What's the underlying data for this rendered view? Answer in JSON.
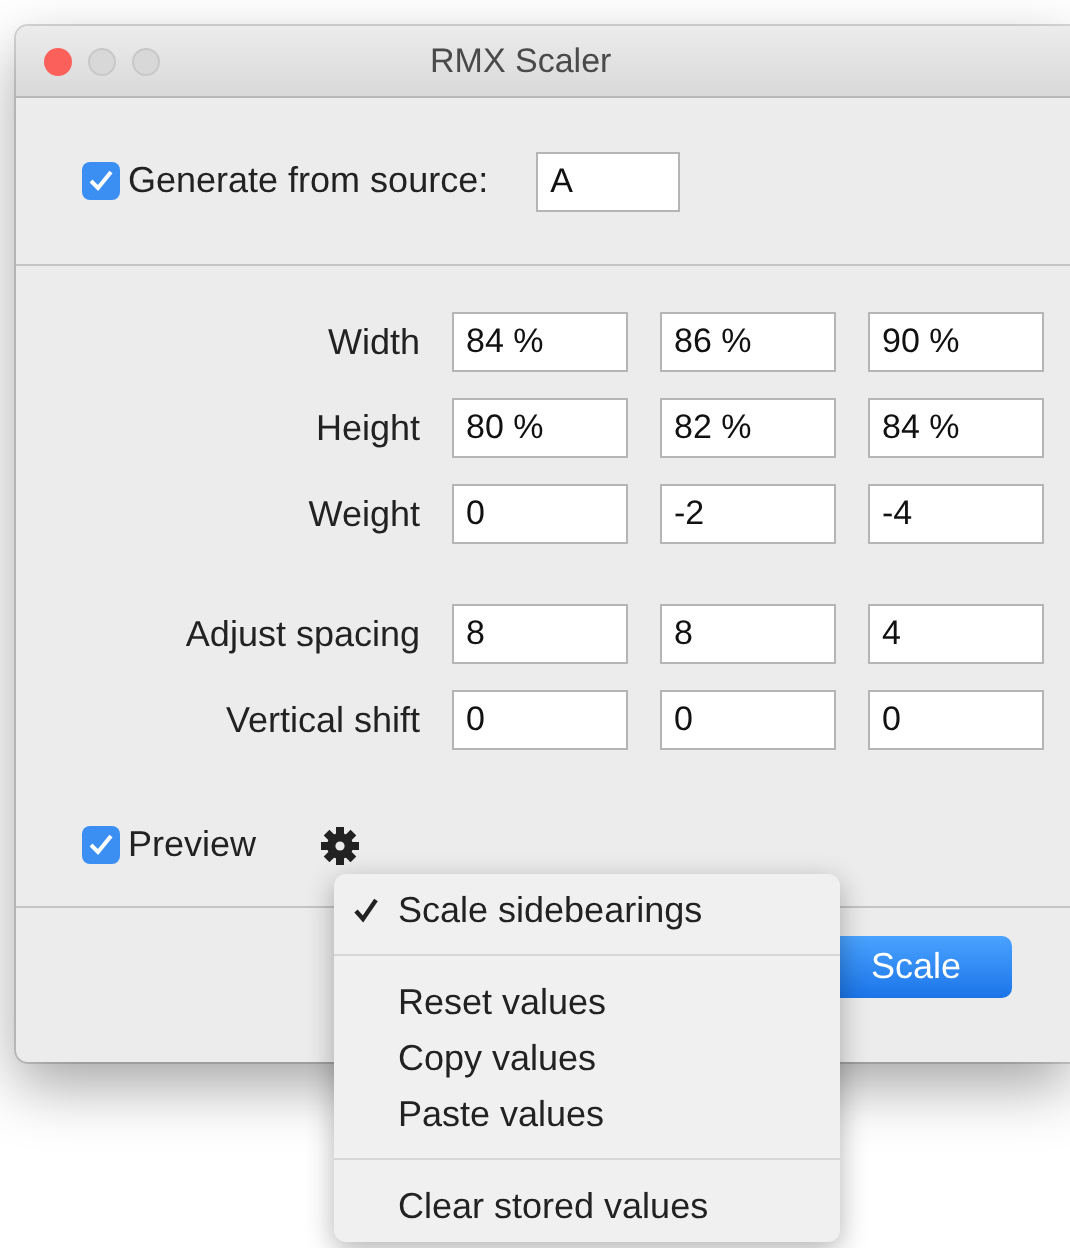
{
  "window": {
    "title": "RMX Scaler"
  },
  "source": {
    "label": "Generate from source:",
    "checked": true,
    "value": "A"
  },
  "groups": [
    {
      "rows": [
        {
          "label": "Width",
          "values": [
            "84 %",
            "86 %",
            "90 %"
          ]
        },
        {
          "label": "Height",
          "values": [
            "80 %",
            "82 %",
            "84 %"
          ]
        },
        {
          "label": "Weight",
          "values": [
            "0",
            "-2",
            "-4"
          ]
        }
      ]
    },
    {
      "rows": [
        {
          "label": "Adjust spacing",
          "values": [
            "8",
            "8",
            "4"
          ]
        },
        {
          "label": "Vertical shift",
          "values": [
            "0",
            "0",
            "0"
          ]
        }
      ]
    }
  ],
  "preview": {
    "label": "Preview",
    "checked": true
  },
  "menu": [
    {
      "kind": "item",
      "label": "Scale sidebearings",
      "checked": true
    },
    {
      "kind": "separator"
    },
    {
      "kind": "item",
      "label": "Reset values",
      "checked": false
    },
    {
      "kind": "item",
      "label": "Copy values",
      "checked": false
    },
    {
      "kind": "item",
      "label": "Paste values",
      "checked": false
    },
    {
      "kind": "separator"
    },
    {
      "kind": "item",
      "label": "Clear stored values",
      "checked": false
    }
  ],
  "buttons": [
    {
      "label": "Scale",
      "kind": "primary"
    }
  ]
}
